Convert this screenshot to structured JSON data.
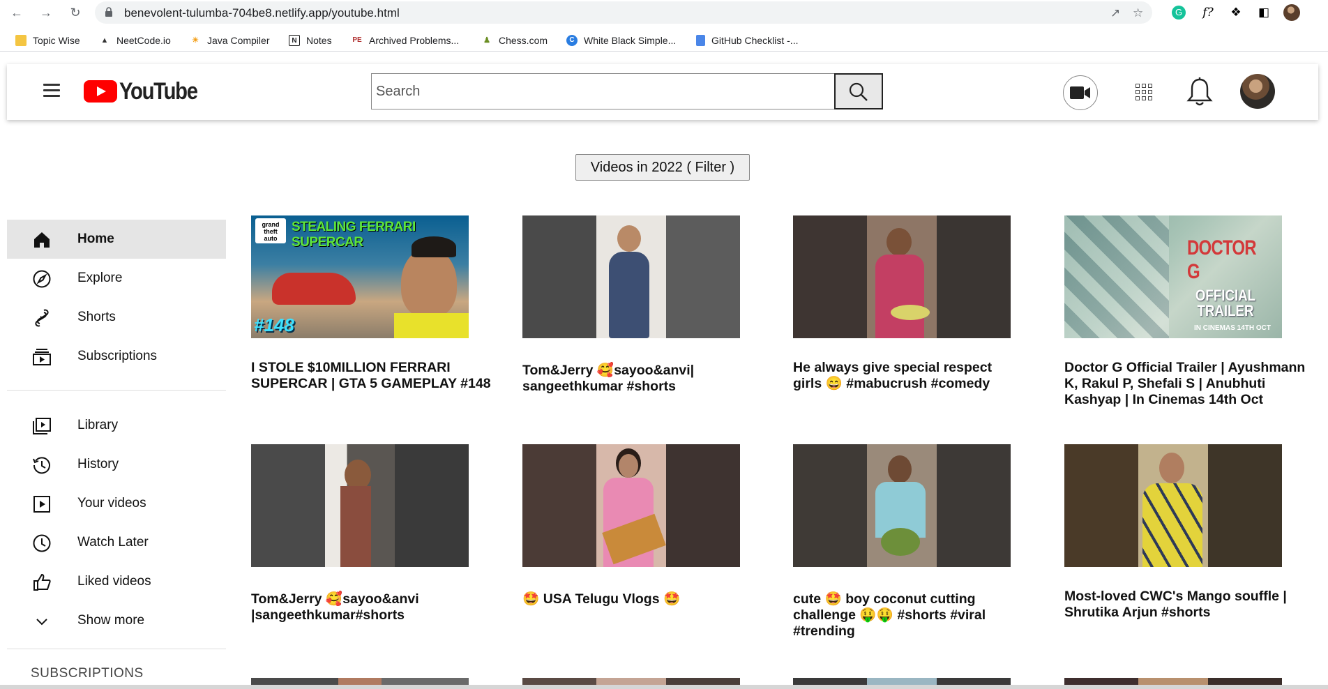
{
  "browser": {
    "url": "benevolent-tulumba-704be8.netlify.app/youtube.html",
    "bookmarks": [
      "Topic Wise",
      "NeetCode.io",
      "Java Compiler",
      "Notes",
      "Archived Problems...",
      "Chess.com",
      "White Black Simple...",
      "GitHub Checklist -..."
    ],
    "ext_f_label": "f?"
  },
  "header": {
    "logo_text": "YouTube",
    "search_placeholder": "Search"
  },
  "filter": {
    "label": "Videos in 2022 ( Filter )"
  },
  "sidebar": {
    "primary": [
      {
        "label": "Home",
        "icon": "home-icon",
        "active": true
      },
      {
        "label": "Explore",
        "icon": "compass-icon"
      },
      {
        "label": "Shorts",
        "icon": "shorts-icon"
      },
      {
        "label": "Subscriptions",
        "icon": "subscriptions-icon"
      }
    ],
    "secondary": [
      {
        "label": "Library",
        "icon": "library-icon"
      },
      {
        "label": "History",
        "icon": "history-icon"
      },
      {
        "label": "Your videos",
        "icon": "your-videos-icon"
      },
      {
        "label": "Watch Later",
        "icon": "clock-icon"
      },
      {
        "label": "Liked videos",
        "icon": "thumbs-up-icon"
      },
      {
        "label": "Show more",
        "icon": "chevron-down-icon"
      }
    ],
    "subscriptions_heading": "SUBSCRIPTIONS"
  },
  "videos": [
    {
      "title": "I STOLE $10MILLION FERRARI SUPERCAR | GTA 5 GAMEPLAY #148",
      "thumb_text": "STEALING FERRARI SUPERCAR",
      "thumb_badge": "#148"
    },
    {
      "title": "Tom&Jerry 🥰sayoo&anvi| sangeethkumar #shorts"
    },
    {
      "title": "He always give special respect girls 😄 #mabucrush #comedy"
    },
    {
      "title": "Doctor G Official Trailer | Ayushmann K, Rakul P, Shefali S | Anubhuti Kashyap | In Cinemas 14th Oct",
      "thumb_text": "DOCTOR G",
      "thumb_badge": "OFFICIAL TRAILER",
      "thumb_sub": "IN CINEMAS 14TH OCT"
    },
    {
      "title": "Tom&Jerry 🥰sayoo&anvi |sangeethkumar#shorts"
    },
    {
      "title": "🤩 USA Telugu Vlogs 🤩"
    },
    {
      "title": "cute 🤩 boy coconut cutting challenge 🤑🤑 #shorts #viral #trending"
    },
    {
      "title": "Most-loved CWC's Mango souffle | Shrutika Arjun #shorts"
    }
  ]
}
